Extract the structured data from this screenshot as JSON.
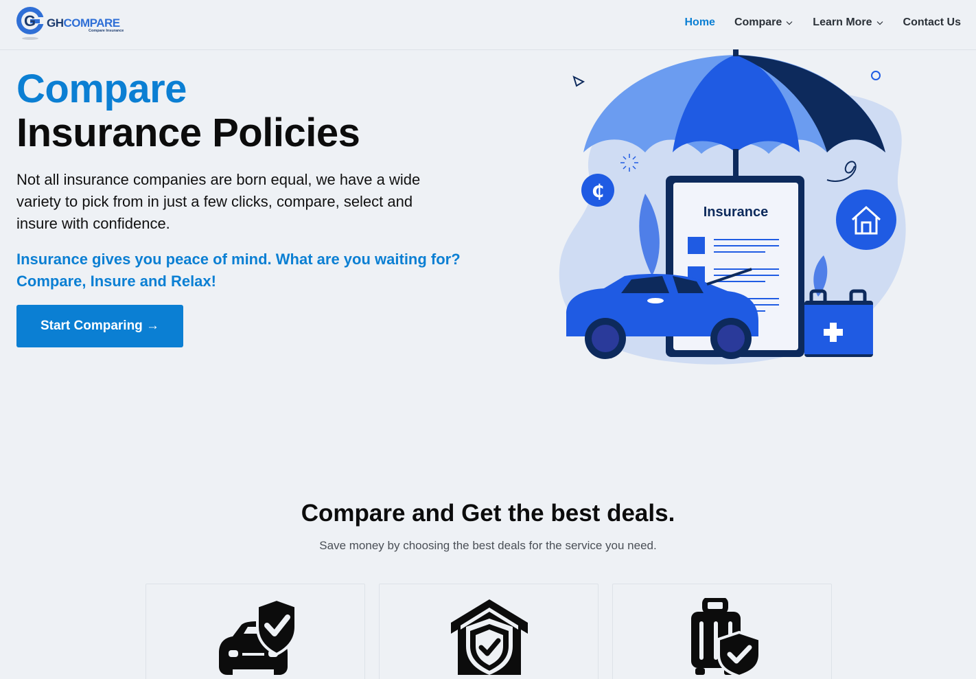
{
  "brand": {
    "logo_letter": "G",
    "name_part1": "GH",
    "name_part2": "COMPARE",
    "tagline": "Compare Insurance"
  },
  "nav": {
    "items": [
      {
        "label": "Home",
        "active": true,
        "dropdown": false
      },
      {
        "label": "Compare",
        "active": false,
        "dropdown": true
      },
      {
        "label": "Learn More",
        "active": false,
        "dropdown": true
      },
      {
        "label": "Contact Us",
        "active": false,
        "dropdown": false
      }
    ]
  },
  "hero": {
    "title_line1": "Compare",
    "title_line2": "Insurance Policies",
    "description": "Not all insurance companies are born equal, we have a wide variety to pick from in just a few clicks, compare, select and insure with confidence.",
    "tagline": "Insurance gives you peace of mind. What are you waiting for? Compare, Insure and Relax!",
    "cta_label": "Start Comparing →",
    "illustration": {
      "document_title": "Insurance",
      "currency_symbol": "₵"
    }
  },
  "deals": {
    "title": "Compare and Get the best deals.",
    "subtitle": "Save money by choosing the best deals for the service you need.",
    "cards": [
      {
        "icon": "car-shield-icon"
      },
      {
        "icon": "house-shield-icon"
      },
      {
        "icon": "luggage-shield-icon"
      }
    ]
  },
  "colors": {
    "accent": "#0b7fd3",
    "background": "#eef1f5",
    "illustration_blue": "#1f5be3",
    "illustration_navy": "#0d2a5c"
  }
}
